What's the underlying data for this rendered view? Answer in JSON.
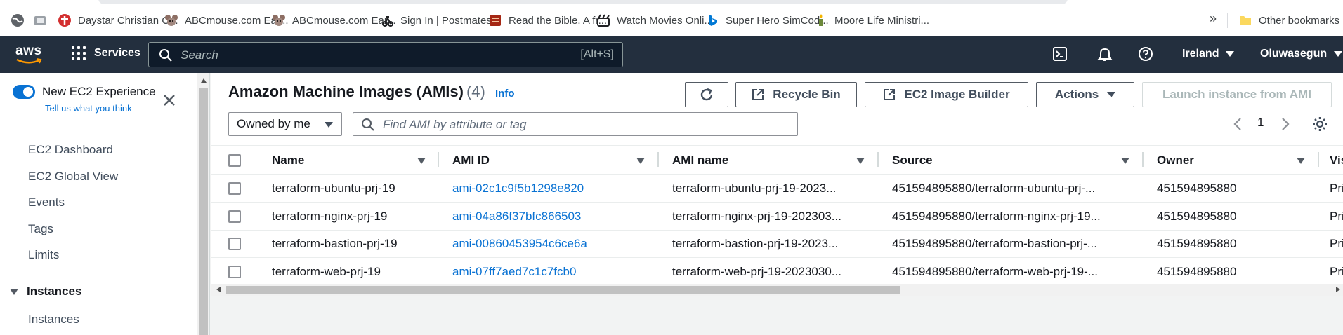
{
  "bookmarks": {
    "items": [
      {
        "label": "Daystar Christian C...",
        "icon": "daystar-icon",
        "color": "#d32f2f"
      },
      {
        "label": "ABCmouse.com Ear...",
        "icon": "mouse-icon",
        "color": "#8d6e63"
      },
      {
        "label": "ABCmouse.com Ear...",
        "icon": "mouse-icon",
        "color": "#8d6e63"
      },
      {
        "label": "Sign In | Postmates...",
        "icon": "postmates-icon",
        "color": "#202124"
      },
      {
        "label": "Read the Bible. A fr...",
        "icon": "bible-icon",
        "color": "#a52714"
      },
      {
        "label": "Watch Movies Onli...",
        "icon": "movie-icon",
        "color": "#202124"
      },
      {
        "label": "Super Hero SimCod...",
        "icon": "bing-icon",
        "color": "#0078d4"
      },
      {
        "label": "Moore Life Ministri...",
        "icon": "candle-icon",
        "color": "#6d8a3b"
      }
    ],
    "more": "»",
    "other": "Other bookmarks"
  },
  "topnav": {
    "logo": "aws",
    "services": "Services",
    "search_placeholder": "Search",
    "search_shortcut": "[Alt+S]",
    "region": "Ireland",
    "user": "Oluwasegun"
  },
  "sidebar": {
    "new_experience": "New EC2 Experience",
    "feedback_link": "Tell us what you think",
    "items": [
      "EC2 Dashboard",
      "EC2 Global View",
      "Events",
      "Tags",
      "Limits"
    ],
    "section": "Instances",
    "section_items": [
      "Instances"
    ]
  },
  "main": {
    "title": "Amazon Machine Images (AMIs)",
    "count": "(4)",
    "info": "Info",
    "buttons": {
      "recycle_bin": "Recycle Bin",
      "image_builder": "EC2 Image Builder",
      "actions": "Actions",
      "launch": "Launch instance from AMI"
    },
    "filter_select": "Owned by me",
    "filter_placeholder": "Find AMI by attribute or tag",
    "page": "1",
    "columns": [
      "Name",
      "AMI ID",
      "AMI name",
      "Source",
      "Owner",
      "Vis"
    ],
    "rows": [
      {
        "name": "terraform-ubuntu-prj-19",
        "ami_id": "ami-02c1c9f5b1298e820",
        "ami_name": "terraform-ubuntu-prj-19-2023...",
        "source": "451594895880/terraform-ubuntu-prj-...",
        "owner": "451594895880",
        "vis": "Pri"
      },
      {
        "name": "terraform-nginx-prj-19",
        "ami_id": "ami-04a86f37bfc866503",
        "ami_name": "terraform-nginx-prj-19-202303...",
        "source": "451594895880/terraform-nginx-prj-19...",
        "owner": "451594895880",
        "vis": "Pri"
      },
      {
        "name": "terraform-bastion-prj-19",
        "ami_id": "ami-00860453954c6ce6a",
        "ami_name": "terraform-bastion-prj-19-2023...",
        "source": "451594895880/terraform-bastion-prj-...",
        "owner": "451594895880",
        "vis": "Pri"
      },
      {
        "name": "terraform-web-prj-19",
        "ami_id": "ami-07ff7aed7c1c7fcb0",
        "ami_name": "terraform-web-prj-19-2023030...",
        "source": "451594895880/terraform-web-prj-19-...",
        "owner": "451594895880",
        "vis": "Pri"
      }
    ]
  },
  "colors": {
    "nav_bg": "#232f3e",
    "link": "#0972d3",
    "toggle_on": "#0972d3"
  }
}
